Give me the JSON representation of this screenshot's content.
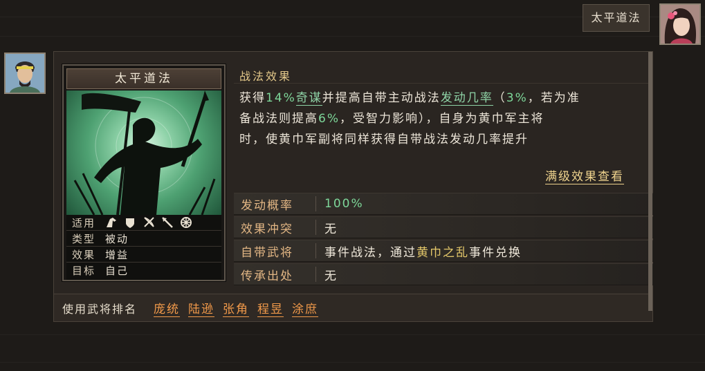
{
  "top_tag": {
    "label": "太平道法"
  },
  "card": {
    "title": "太平道法",
    "stats": [
      {
        "key": "适用",
        "icons": [
          "cavalry-icon",
          "shield-icon",
          "archer-icon",
          "spear-icon",
          "siege-icon"
        ]
      },
      {
        "key": "类型",
        "value": "被动"
      },
      {
        "key": "效果",
        "value": "增益"
      },
      {
        "key": "目标",
        "value": "自己"
      }
    ]
  },
  "effect": {
    "heading": "战法效果",
    "line1_a": "获得",
    "line1_b": "14%",
    "line1_c": "奇谋",
    "line1_d": "并提高自带主动战法",
    "line1_e": "发动几率",
    "line1_f": "（",
    "line1_g": "3%",
    "line1_h": "，若为准",
    "line2_a": "备战法则提高",
    "line2_b": "6%",
    "line2_c": "，受智力影响），自身为黄巾军主将",
    "line3": "时，使黄巾军副将同样获得自带战法发动几率提升",
    "detail_link": "满级效果查看"
  },
  "attributes": [
    {
      "key": "发动概率",
      "value": "100%"
    },
    {
      "key": "效果冲突",
      "value": "无"
    },
    {
      "key": "自带武将",
      "value_a": "事件战法，通过",
      "value_b": "黄巾之乱",
      "value_c": "事件兑换"
    },
    {
      "key": "传承出处",
      "value": "无"
    }
  ],
  "users": {
    "label": "使用武将排名",
    "names": [
      "庞统",
      "陆逊",
      "张角",
      "程昱",
      "涂庶"
    ]
  },
  "colors": {
    "accent_green": "#7ed89a",
    "accent_orange": "#f29a4a",
    "accent_gold": "#f0d48e",
    "attr_key": "#e2b684"
  }
}
